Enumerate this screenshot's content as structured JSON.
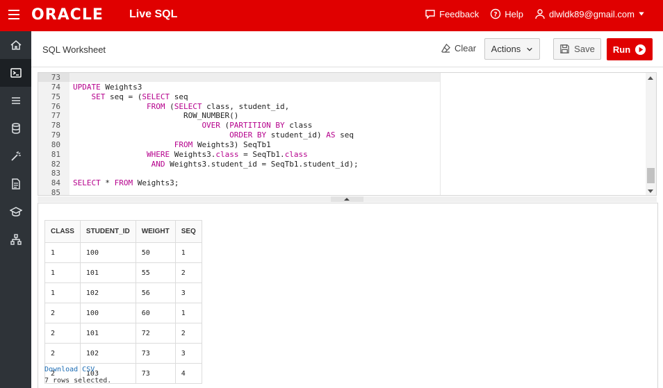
{
  "header": {
    "logo": "ORACLE",
    "app_name": "Live SQL",
    "feedback": "Feedback",
    "help": "Help",
    "user": "dlwldk89@gmail.com"
  },
  "sidebar": {
    "items": [
      {
        "icon": "home-icon"
      },
      {
        "icon": "terminal-icon",
        "active": true
      },
      {
        "icon": "list-icon"
      },
      {
        "icon": "database-icon"
      },
      {
        "icon": "magic-wand-icon"
      },
      {
        "icon": "document-icon"
      },
      {
        "icon": "graduation-cap-icon"
      },
      {
        "icon": "hierarchy-icon"
      }
    ]
  },
  "worksheet": {
    "title": "SQL Worksheet",
    "clear_label": "Clear",
    "actions_label": "Actions",
    "save_label": "Save",
    "run_label": "Run"
  },
  "editor": {
    "lines": [
      {
        "n": "73",
        "t": ""
      },
      {
        "n": "74",
        "t": "UPDATE Weights3"
      },
      {
        "n": "75",
        "t": "    SET seq = (SELECT seq"
      },
      {
        "n": "76",
        "t": "                FROM (SELECT class, student_id,"
      },
      {
        "n": "77",
        "t": "                        ROW_NUMBER()"
      },
      {
        "n": "78",
        "t": "                            OVER (PARTITION BY class"
      },
      {
        "n": "79",
        "t": "                                  ORDER BY student_id) AS seq"
      },
      {
        "n": "80",
        "t": "                      FROM Weights3) SeqTb1"
      },
      {
        "n": "81",
        "t": "                WHERE Weights3.class = SeqTb1.class"
      },
      {
        "n": "82",
        "t": "                 AND Weights3.student_id = SeqTb1.student_id);"
      },
      {
        "n": "83",
        "t": ""
      },
      {
        "n": "84",
        "t": "SELECT * FROM Weights3;"
      },
      {
        "n": "85",
        "t": ""
      }
    ]
  },
  "results": {
    "columns": [
      "CLASS",
      "STUDENT_ID",
      "WEIGHT",
      "SEQ"
    ],
    "rows": [
      [
        "1",
        "100",
        "50",
        "1"
      ],
      [
        "1",
        "101",
        "55",
        "2"
      ],
      [
        "1",
        "102",
        "56",
        "3"
      ],
      [
        "2",
        "100",
        "60",
        "1"
      ],
      [
        "2",
        "101",
        "72",
        "2"
      ],
      [
        "2",
        "102",
        "73",
        "3"
      ],
      [
        "2",
        "103",
        "73",
        "4"
      ]
    ],
    "download_label": "Download CSV",
    "rows_selected": "7 rows selected."
  },
  "colors": {
    "brand_red": "#e00000",
    "sidebar_bg": "#2e3338",
    "keyword": "#b5008c",
    "link": "#1a6bb3"
  }
}
